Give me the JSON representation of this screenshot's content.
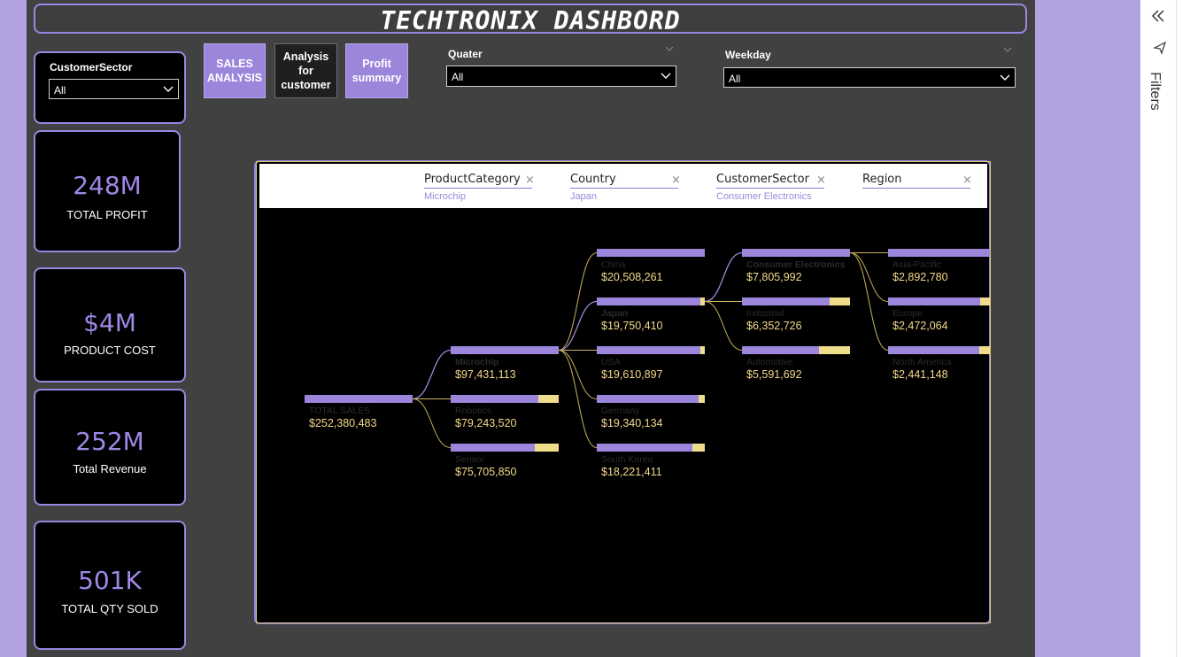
{
  "dashboard": {
    "title": "TECHTRONIX DASHBORD"
  },
  "slicers": {
    "customer_sector": {
      "title": "CustomerSector",
      "value": "All"
    },
    "quater": {
      "title": "Quater",
      "value": "All"
    },
    "weekday": {
      "title": "Weekday",
      "value": "All"
    }
  },
  "kpis": [
    {
      "value": "248M",
      "label": "TOTAL PROFIT"
    },
    {
      "value": "$4M",
      "label": "PRODUCT COST"
    },
    {
      "value": "252M",
      "label": "Total Revenue"
    },
    {
      "value": "501K",
      "label": "TOTAL QTY SOLD"
    }
  ],
  "nav": {
    "sales": "SALES ANALYSIS",
    "customer": "Analysis for customer",
    "profit": "Profit summary"
  },
  "tree": {
    "levels": [
      {
        "name": "ProductCategory",
        "selected": "Microchip"
      },
      {
        "name": "Country",
        "selected": "Japan"
      },
      {
        "name": "CustomerSector",
        "selected": "Consumer Electronics"
      },
      {
        "name": "Region",
        "selected": ""
      }
    ],
    "root": {
      "label": "TOTAL SALES",
      "value": "$252,380,483",
      "amount": 252380483
    },
    "columns": [
      [
        {
          "label": "Microchip",
          "value": "$97,431,113",
          "amount": 97431113,
          "selected": true
        },
        {
          "label": "Robotics",
          "value": "$79,243,520",
          "amount": 79243520
        },
        {
          "label": "Sensor",
          "value": "$75,705,850",
          "amount": 75705850
        }
      ],
      [
        {
          "label": "China",
          "value": "$20,508,261",
          "amount": 20508261
        },
        {
          "label": "Japan",
          "value": "$19,750,410",
          "amount": 19750410,
          "selected": true
        },
        {
          "label": "USA",
          "value": "$19,610,897",
          "amount": 19610897
        },
        {
          "label": "Germany",
          "value": "$19,340,134",
          "amount": 19340134
        },
        {
          "label": "South Korea",
          "value": "$18,221,411",
          "amount": 18221411
        }
      ],
      [
        {
          "label": "Consumer Electronics",
          "value": "$7,805,992",
          "amount": 7805992,
          "selected": true
        },
        {
          "label": "Industrial",
          "value": "$6,352,726",
          "amount": 6352726
        },
        {
          "label": "Automotive",
          "value": "$5,591,692",
          "amount": 5591692
        }
      ],
      [
        {
          "label": "Asia-Pacific",
          "value": "$2,892,780",
          "amount": 2892780
        },
        {
          "label": "Europe",
          "value": "$2,472,064",
          "amount": 2472064
        },
        {
          "label": "North America",
          "value": "$2,441,148",
          "amount": 2441148
        }
      ]
    ],
    "colors": {
      "bar": "#9b86dc",
      "remainder": "#f0dd8c",
      "link_active": "#9b86dc",
      "link": "#c8b35a",
      "value": "#f3d98a",
      "label": "#2a2a2a"
    }
  },
  "right_panel": {
    "filters_label": "Filters"
  }
}
